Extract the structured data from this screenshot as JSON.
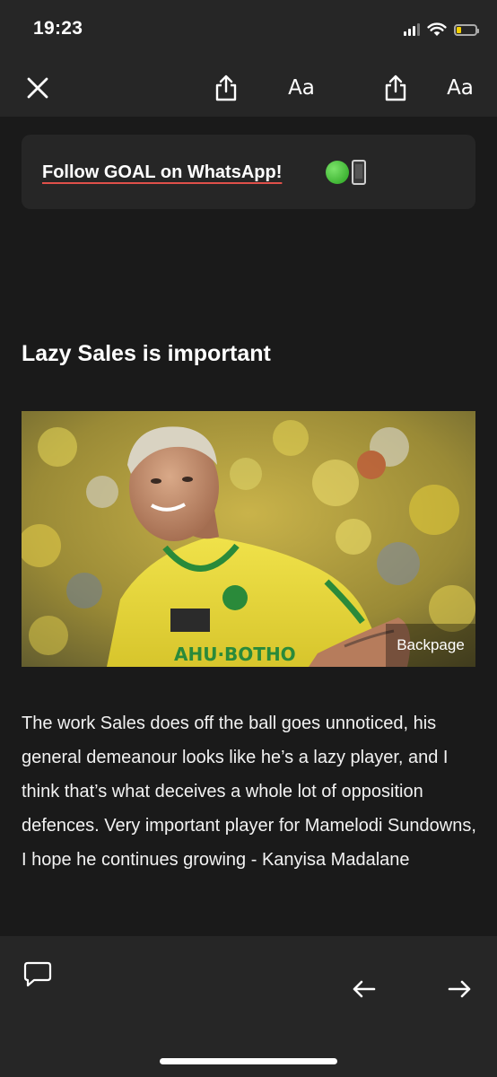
{
  "status_bar": {
    "time": "19:23",
    "battery_level": 0.25,
    "signal_bars": 4,
    "signal_bars_active": 3
  },
  "toolbar": {
    "close_icon": "close-icon",
    "share_icon": "share-icon",
    "text_size_label": "Aa"
  },
  "promo": {
    "link_text": "Follow GOAL on WhatsApp!",
    "emoji": [
      "green-circle-emoji",
      "mobile-phone-emoji"
    ]
  },
  "article": {
    "heading": "Lazy Sales is important",
    "image_caption": "Backpage",
    "body": "The work Sales does off the ball goes unnoticed, his general demeanour looks like he’s a lazy player, and I think that’s what deceives a whole lot of opposition defences. Very important player for Mamelodi Sundowns, I hope he continues growing - Kanyisa Madalane"
  },
  "bottom_bar": {
    "comment_icon": "comment-icon",
    "back_icon": "arrow-left-icon",
    "forward_icon": "arrow-right-icon"
  },
  "colors": {
    "background": "#1a1a1a",
    "bar": "#262626",
    "link_underline": "#e0504a",
    "battery": "#f5d000"
  }
}
